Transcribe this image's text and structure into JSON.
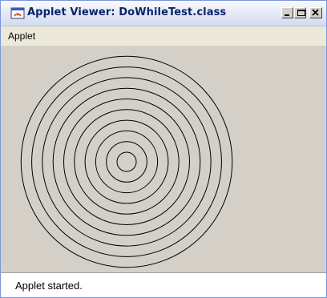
{
  "window": {
    "title": "Applet Viewer: DoWhileTest.class",
    "app_icon": "java-applet-icon",
    "controls": {
      "minimize": "minimize-icon",
      "maximize": "maximize-icon",
      "close": "close-icon"
    }
  },
  "menubar": {
    "items": [
      {
        "label": "Applet"
      }
    ]
  },
  "applet": {
    "drawing": "concentric-circles",
    "circle_count": 10,
    "stroke_color": "#000000",
    "background_color": "#d4d0c8"
  },
  "status": {
    "text": "Applet started."
  }
}
